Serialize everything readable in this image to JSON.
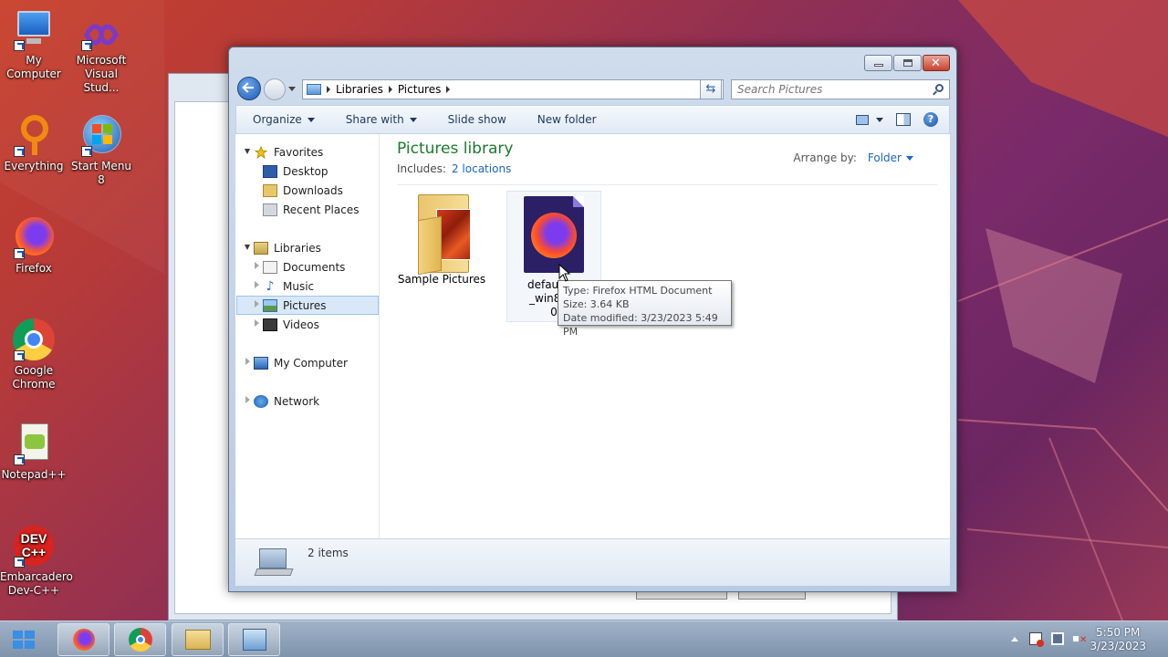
{
  "desktop": {
    "icons": [
      {
        "label": "My\nComputer",
        "icon": "my-computer-icon"
      },
      {
        "label": "Microsoft\nVisual Stud...",
        "icon": "visual-studio-icon"
      },
      {
        "label": "Everything",
        "icon": "everything-icon"
      },
      {
        "label": "Start Menu 8",
        "icon": "start-menu-8-icon"
      },
      {
        "label": "Firefox",
        "icon": "firefox-icon"
      },
      {
        "label": "Google\nChrome",
        "icon": "chrome-icon"
      },
      {
        "label": "Notepad++",
        "icon": "notepad-plus-plus-icon"
      },
      {
        "label": "Embarcadero\nDev-C++",
        "icon": "dev-cpp-icon"
      }
    ]
  },
  "explorer": {
    "address": {
      "crumbs": [
        "Libraries",
        "Pictures"
      ]
    },
    "search": {
      "placeholder": "Search Pictures"
    },
    "toolbar": {
      "organize": "Organize",
      "share_with": "Share with",
      "slide_show": "Slide show",
      "new_folder": "New folder"
    },
    "nav": {
      "favorites": "Favorites",
      "desktop": "Desktop",
      "downloads": "Downloads",
      "recent_places": "Recent Places",
      "libraries": "Libraries",
      "documents": "Documents",
      "music": "Music",
      "pictures": "Pictures",
      "videos": "Videos",
      "my_computer": "My Computer",
      "network": "Network"
    },
    "library": {
      "title": "Pictures library",
      "includes_label": "Includes:",
      "locations": "2 locations",
      "arrange_label": "Arrange by:",
      "arrange_value": "Folder"
    },
    "files": [
      {
        "name": "Sample Pictures",
        "type": "folder"
      },
      {
        "name": "default_w\n_win81-b\n0",
        "type": "firefox-html"
      }
    ],
    "tooltip": {
      "type": "Type: Firefox HTML Document",
      "size": "Size: 3.64 KB",
      "modified": "Date modified: 3/23/2023 5:49 PM"
    },
    "details": {
      "count": "2 items"
    }
  },
  "taskbar": {
    "clock_time": "5:50 PM",
    "clock_date": "3/23/2023",
    "apps": [
      "firefox-icon",
      "chrome-icon",
      "file-explorer-icon",
      "control-panel-icon"
    ]
  }
}
